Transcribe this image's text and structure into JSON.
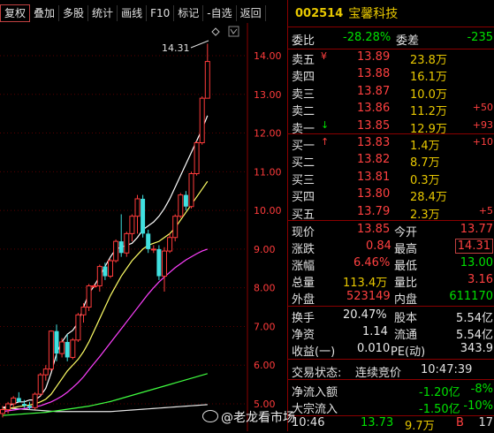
{
  "toolbar": {
    "buttons": [
      "复权",
      "叠加",
      "多股",
      "统计",
      "画线",
      "F10",
      "标记",
      "-自选",
      "返回"
    ]
  },
  "chart": {
    "max_annotation": "14.31",
    "diamond_icon": "diamond-icon",
    "y_ticks": [
      "14.00",
      "13.00",
      "12.00",
      "11.00",
      "10.00",
      "9.00",
      "8.00",
      "7.00",
      "6.00",
      "5.00"
    ],
    "colors": {
      "up": "#ff3b3b",
      "down": "#40e0e0",
      "ma5": "#ffffff",
      "ma10": "#ffff66",
      "ma20": "#ff40ff",
      "ma60": "#40ff40",
      "ma120": "#e8e8e8",
      "axis": "#8b0000"
    }
  },
  "chart_data": {
    "type": "candlestick",
    "y_range": [
      4.6,
      14.6
    ],
    "candles": [
      {
        "o": 4.75,
        "h": 4.95,
        "l": 4.65,
        "c": 4.85
      },
      {
        "o": 4.85,
        "h": 5.05,
        "l": 4.75,
        "c": 5.0
      },
      {
        "o": 5.0,
        "h": 5.2,
        "l": 4.9,
        "c": 5.15
      },
      {
        "o": 5.15,
        "h": 5.3,
        "l": 5.05,
        "c": 5.05
      },
      {
        "o": 5.0,
        "h": 5.1,
        "l": 4.9,
        "c": 4.95
      },
      {
        "o": 4.95,
        "h": 5.05,
        "l": 4.85,
        "c": 4.9
      },
      {
        "o": 4.9,
        "h": 5.3,
        "l": 4.85,
        "c": 5.25
      },
      {
        "o": 5.25,
        "h": 5.8,
        "l": 5.2,
        "c": 5.75
      },
      {
        "o": 5.75,
        "h": 6.0,
        "l": 5.6,
        "c": 5.9
      },
      {
        "o": 5.9,
        "h": 6.9,
        "l": 5.85,
        "c": 6.88
      },
      {
        "o": 6.88,
        "h": 7.05,
        "l": 6.1,
        "c": 6.3
      },
      {
        "o": 6.3,
        "h": 6.7,
        "l": 6.2,
        "c": 6.6
      },
      {
        "o": 6.6,
        "h": 6.8,
        "l": 6.1,
        "c": 6.2
      },
      {
        "o": 6.2,
        "h": 6.7,
        "l": 6.15,
        "c": 6.65
      },
      {
        "o": 6.65,
        "h": 7.35,
        "l": 6.6,
        "c": 7.3
      },
      {
        "o": 7.3,
        "h": 7.6,
        "l": 7.1,
        "c": 7.5
      },
      {
        "o": 7.5,
        "h": 8.1,
        "l": 7.4,
        "c": 8.05
      },
      {
        "o": 8.05,
        "h": 8.1,
        "l": 8.0,
        "c": 8.05
      },
      {
        "o": 8.05,
        "h": 8.6,
        "l": 7.9,
        "c": 8.55
      },
      {
        "o": 8.55,
        "h": 8.65,
        "l": 8.2,
        "c": 8.3
      },
      {
        "o": 8.3,
        "h": 8.75,
        "l": 8.25,
        "c": 8.7
      },
      {
        "o": 8.7,
        "h": 9.25,
        "l": 8.65,
        "c": 9.2
      },
      {
        "o": 9.2,
        "h": 9.9,
        "l": 8.8,
        "c": 8.9
      },
      {
        "o": 8.9,
        "h": 9.45,
        "l": 8.8,
        "c": 9.4
      },
      {
        "o": 9.4,
        "h": 9.9,
        "l": 9.2,
        "c": 9.85
      },
      {
        "o": 9.85,
        "h": 10.4,
        "l": 9.4,
        "c": 10.3
      },
      {
        "o": 10.3,
        "h": 10.4,
        "l": 9.3,
        "c": 9.4
      },
      {
        "o": 9.4,
        "h": 9.5,
        "l": 8.9,
        "c": 9.0
      },
      {
        "o": 9.0,
        "h": 9.1,
        "l": 8.9,
        "c": 9.0
      },
      {
        "o": 9.0,
        "h": 9.1,
        "l": 8.2,
        "c": 8.3
      },
      {
        "o": 8.3,
        "h": 9.05,
        "l": 7.9,
        "c": 8.95
      },
      {
        "o": 8.95,
        "h": 9.4,
        "l": 8.9,
        "c": 9.3
      },
      {
        "o": 9.3,
        "h": 9.9,
        "l": 9.2,
        "c": 9.85
      },
      {
        "o": 9.85,
        "h": 10.45,
        "l": 9.8,
        "c": 10.4
      },
      {
        "o": 10.4,
        "h": 10.5,
        "l": 10.0,
        "c": 10.1
      },
      {
        "o": 10.1,
        "h": 11.0,
        "l": 10.05,
        "c": 10.95
      },
      {
        "o": 10.95,
        "h": 11.8,
        "l": 10.9,
        "c": 11.75
      },
      {
        "o": 11.75,
        "h": 12.95,
        "l": 11.7,
        "c": 12.9
      },
      {
        "o": 12.9,
        "h": 14.31,
        "l": 12.95,
        "c": 13.85
      }
    ],
    "ma5": [
      4.9,
      4.95,
      5.0,
      5.05,
      5.05,
      5.1,
      5.1,
      5.2,
      5.4,
      5.8,
      6.3,
      6.6,
      6.8,
      6.9,
      7.1,
      7.5,
      7.85,
      8.05,
      8.3,
      8.55,
      8.8,
      9.0,
      9.05,
      9.1,
      9.15,
      9.3,
      9.5,
      9.6,
      9.7,
      9.85,
      10.05,
      10.3,
      10.6,
      10.9,
      11.2,
      11.5,
      11.8,
      12.1,
      12.45
    ],
    "ma10": [
      4.85,
      4.88,
      4.9,
      4.93,
      4.95,
      4.97,
      5.0,
      5.05,
      5.12,
      5.25,
      5.45,
      5.65,
      5.85,
      6.0,
      6.15,
      6.35,
      6.6,
      6.9,
      7.2,
      7.5,
      7.8,
      8.05,
      8.3,
      8.5,
      8.7,
      8.85,
      9.0,
      9.1,
      9.15,
      9.2,
      9.3,
      9.4,
      9.55,
      9.75,
      9.95,
      10.15,
      10.35,
      10.55,
      10.75
    ],
    "ma20": [
      4.8,
      4.82,
      4.84,
      4.86,
      4.88,
      4.9,
      4.92,
      4.95,
      5.0,
      5.05,
      5.12,
      5.2,
      5.3,
      5.42,
      5.55,
      5.7,
      5.88,
      6.05,
      6.22,
      6.4,
      6.58,
      6.76,
      6.94,
      7.12,
      7.3,
      7.48,
      7.66,
      7.84,
      8.0,
      8.15,
      8.28,
      8.4,
      8.52,
      8.62,
      8.72,
      8.8,
      8.88,
      8.95,
      9.0
    ],
    "ma60": [
      4.7,
      4.71,
      4.72,
      4.73,
      4.74,
      4.75,
      4.76,
      4.77,
      4.78,
      4.8,
      4.82,
      4.84,
      4.86,
      4.88,
      4.9,
      4.92,
      4.94,
      4.97,
      5.0,
      5.03,
      5.06,
      5.1,
      5.14,
      5.18,
      5.22,
      5.26,
      5.3,
      5.34,
      5.38,
      5.42,
      5.46,
      5.5,
      5.54,
      5.58,
      5.62,
      5.66,
      5.7,
      5.74,
      5.78
    ],
    "ma120": [
      4.9,
      4.89,
      4.88,
      4.87,
      4.86,
      4.85,
      4.84,
      4.83,
      4.82,
      4.81,
      4.8,
      4.8,
      4.8,
      4.8,
      4.8,
      4.8,
      4.8,
      4.8,
      4.8,
      4.8,
      4.8,
      4.81,
      4.82,
      4.83,
      4.84,
      4.85,
      4.86,
      4.87,
      4.88,
      4.89,
      4.9,
      4.91,
      4.92,
      4.93,
      4.94,
      4.95,
      4.96,
      4.97,
      4.98
    ]
  },
  "panel": {
    "code": "002514",
    "name": "宝馨科技",
    "weibi_label": "委比",
    "weibi": "-28.28%",
    "weicha_label": "委差",
    "weicha": "-235",
    "sells": [
      {
        "label": "卖五",
        "flag": "¥",
        "price": "13.89",
        "vol": "23.8万",
        "chg": ""
      },
      {
        "label": "卖四",
        "flag": "",
        "price": "13.88",
        "vol": "16.1万",
        "chg": ""
      },
      {
        "label": "卖三",
        "flag": "",
        "price": "13.87",
        "vol": "10.0万",
        "chg": ""
      },
      {
        "label": "卖二",
        "flag": "",
        "price": "13.86",
        "vol": "11.2万",
        "chg": "+50"
      },
      {
        "label": "卖一",
        "flag": "↓",
        "price": "13.85",
        "vol": "12.9万",
        "chg": "+93"
      }
    ],
    "buys": [
      {
        "label": "买一",
        "flag": "↑",
        "price": "13.83",
        "vol": "1.4万",
        "chg": "+10"
      },
      {
        "label": "买二",
        "flag": "",
        "price": "13.82",
        "vol": "8.7万",
        "chg": ""
      },
      {
        "label": "买三",
        "flag": "",
        "price": "13.81",
        "vol": "0.3万",
        "chg": ""
      },
      {
        "label": "买四",
        "flag": "",
        "price": "13.80",
        "vol": "28.4万",
        "chg": ""
      },
      {
        "label": "买五",
        "flag": "",
        "price": "13.79",
        "vol": "2.3万",
        "chg": "+5"
      }
    ],
    "stats": {
      "xj_l": "现价",
      "xj": "13.85",
      "jk_l": "今开",
      "jk": "13.77",
      "zd_l": "涨跌",
      "zd": "0.84",
      "zg_l": "最高",
      "zg": "14.31",
      "zf_l": "涨幅",
      "zf": "6.46%",
      "zdi_l": "最低",
      "zdi": "13.00",
      "zl_l": "总量",
      "zl": "113.4万",
      "lb_l": "量比",
      "lb": "3.16",
      "wp_l": "外盘",
      "wp": "523149",
      "np_l": "内盘",
      "np": "611170"
    },
    "fin": {
      "hs_l": "换手",
      "hs": "20.47%",
      "gb_l": "股本",
      "gb": "5.54亿",
      "jz_l": "净资",
      "jz": "1.14",
      "lt_l": "流通",
      "lt": "5.54亿",
      "sy_l": "收益(一)",
      "sy": "0.010",
      "pe_l": "PE(动)",
      "pe": "343.9"
    },
    "status_l": "交易状态:",
    "status": "连续竞价",
    "time": "10:47:39",
    "flow": [
      {
        "label": "净流入额",
        "val": "-1.20亿",
        "pct": "-8%"
      },
      {
        "label": "大宗流入",
        "val": "-1.50亿",
        "pct": "-10%"
      }
    ],
    "tick": {
      "time": "10:46",
      "price": "13.73",
      "vol": "9.7万",
      "bs": "B",
      "n": "17"
    }
  },
  "watermark": "@老龙看市场"
}
